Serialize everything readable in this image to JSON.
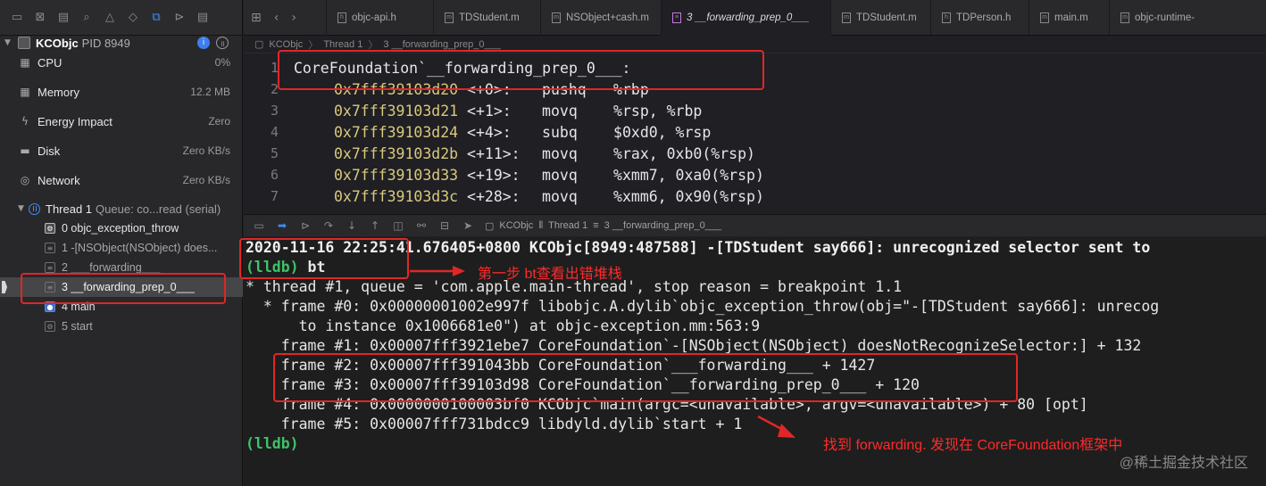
{
  "process": {
    "name": "KCObjc",
    "pid": "PID 8949"
  },
  "gauges": [
    {
      "name": "CPU",
      "value": "0%",
      "icon": "cpu-gauge-icon",
      "level": 0.0
    },
    {
      "name": "Memory",
      "value": "12.2 MB",
      "icon": "memory-gauge-icon",
      "level": 0.0
    },
    {
      "name": "Energy Impact",
      "value": "Zero",
      "icon": "energy-bolt-icon"
    },
    {
      "name": "Disk",
      "value": "Zero KB/s",
      "icon": "disk-icon"
    },
    {
      "name": "Network",
      "value": "Zero KB/s",
      "icon": "network-icon"
    }
  ],
  "thread": {
    "name": "Thread 1",
    "queue": "Queue: co...read (serial)"
  },
  "frames": [
    {
      "label": "0 objc_exception_throw",
      "kind": "user"
    },
    {
      "label": "1 -[NSObject(NSObject) does...",
      "kind": "sys"
    },
    {
      "label": "2 ___forwarding___",
      "kind": "sys"
    },
    {
      "label": "3 __forwarding_prep_0___",
      "kind": "sys",
      "selected": true
    },
    {
      "label": "4 main",
      "kind": "blue"
    },
    {
      "label": "5 start",
      "kind": "sys"
    }
  ],
  "tabs": [
    "objc-api.h",
    "TDStudent.m",
    "NSObject+cash.m",
    "3 __forwarding_prep_0___",
    "TDStudent.m",
    "TDPerson.h",
    "main.m",
    "objc-runtime-"
  ],
  "active_tab_index": 3,
  "jumpbar": {
    "app": "KCObjc",
    "thread": "Thread 1",
    "frame": "3 __forwarding_prep_0___"
  },
  "disassembly": [
    {
      "ln": "1",
      "label": "CoreFoundation`__forwarding_prep_0___:"
    },
    {
      "ln": "2",
      "addr": "0x7fff39103d20",
      "off": "<+0>:",
      "op": "pushq",
      "args": "%rbp"
    },
    {
      "ln": "3",
      "addr": "0x7fff39103d21",
      "off": "<+1>:",
      "op": "movq",
      "args": "%rsp, %rbp"
    },
    {
      "ln": "4",
      "addr": "0x7fff39103d24",
      "off": "<+4>:",
      "op": "subq",
      "args": "$0xd0, %rsp"
    },
    {
      "ln": "5",
      "addr": "0x7fff39103d2b",
      "off": "<+11>:",
      "op": "movq",
      "args": "%rax, 0xb0(%rsp)"
    },
    {
      "ln": "6",
      "addr": "0x7fff39103d33",
      "off": "<+19>:",
      "op": "movq",
      "args": "%xmm7, 0xa0(%rsp)"
    },
    {
      "ln": "7",
      "addr": "0x7fff39103d3c",
      "off": "<+28>:",
      "op": "movq",
      "args": "%xmm6, 0x90(%rsp)"
    }
  ],
  "debug_crumb": {
    "app": "KCObjc",
    "thread": "Thread 1",
    "frame": "3 __forwarding_prep_0___"
  },
  "console": {
    "log": "2020-11-16 22:25:41.676405+0800 KCObjc[8949:487588] -[TDStudent say666]: unrecognized selector sent to",
    "prompt": "(lldb)",
    "cmd": " bt",
    "lines": [
      "* thread #1, queue = 'com.apple.main-thread', stop reason = breakpoint 1.1",
      "  * frame #0: 0x00000001002e997f libobjc.A.dylib`objc_exception_throw(obj=\"-[TDStudent say666]: unrecog",
      "      to instance 0x1006681e0\") at objc-exception.mm:563:9",
      "    frame #1: 0x00007fff3921ebe7 CoreFoundation`-[NSObject(NSObject) doesNotRecognizeSelector:] + 132",
      "    frame #2: 0x00007fff391043bb CoreFoundation`___forwarding___ + 1427",
      "    frame #3: 0x00007fff39103d98 CoreFoundation`__forwarding_prep_0___ + 120",
      "    frame #4: 0x0000000100003bf0 KCObjc`main(argc=<unavailable>, argv=<unavailable>) + 80 [opt]",
      "    frame #5: 0x00007fff731bdcc9 libdyld.dylib`start + 1"
    ],
    "final_prompt": "(lldb)"
  },
  "annotations": {
    "step1": "第一步 bt查看出错堆栈",
    "step2": "找到 forwarding. 发现在 CoreFoundation框架中",
    "watermark": "@稀土掘金技术社区"
  },
  "colors": {
    "annotation": "#e02727",
    "lldb_prompt": "#3fc26a",
    "address": "#d9c97c",
    "accent": "#3d8df5"
  }
}
